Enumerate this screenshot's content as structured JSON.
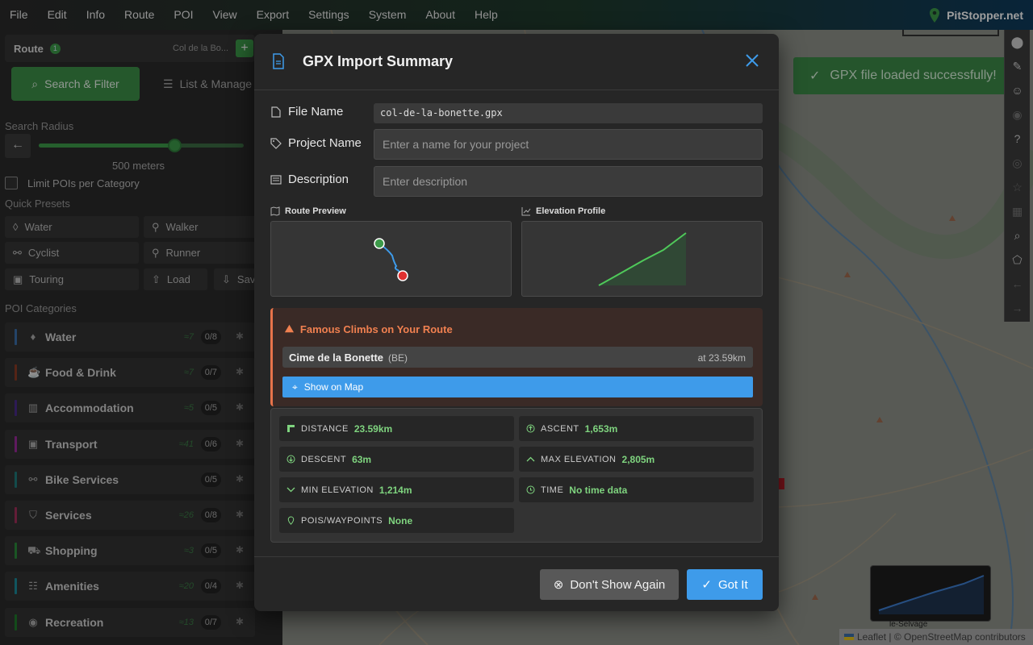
{
  "menu": [
    "File",
    "Edit",
    "Info",
    "Route",
    "POI",
    "View",
    "Export",
    "Settings",
    "System",
    "About",
    "Help"
  ],
  "brand": "PitStopper.net",
  "sidebar": {
    "route_label": "Route",
    "route_count": "1",
    "route_name": "Col de la Bo...",
    "tab_search": "Search & Filter",
    "tab_list": "List & Manage",
    "search_radius_label": "Search Radius",
    "radius_value": "500 meters",
    "radius_fraction": 0.66,
    "limit_label": "Limit POIs per Category",
    "quick_presets_label": "Quick Presets",
    "presets": [
      "Water",
      "Walker",
      "Cyclist",
      "Runner",
      "Touring",
      "Load",
      "Sav"
    ],
    "poi_categories_label": "POI Categories",
    "categories": [
      {
        "name": "Water",
        "count": "≈7",
        "ratio": "0/8",
        "color": "#3a6ea8"
      },
      {
        "name": "Food & Drink",
        "count": "≈7",
        "ratio": "0/7",
        "color": "#8a3a25"
      },
      {
        "name": "Accommodation",
        "count": "≈5",
        "ratio": "0/5",
        "color": "#4a2a8a"
      },
      {
        "name": "Transport",
        "count": "≈41",
        "ratio": "0/6",
        "color": "#9a2a9a"
      },
      {
        "name": "Bike Services",
        "count": "",
        "ratio": "0/5",
        "color": "#1f7a7a"
      },
      {
        "name": "Services",
        "count": "≈26",
        "ratio": "0/8",
        "color": "#a0305a"
      },
      {
        "name": "Shopping",
        "count": "≈3",
        "ratio": "0/5",
        "color": "#2a8a3a"
      },
      {
        "name": "Amenities",
        "count": "≈20",
        "ratio": "0/4",
        "color": "#1a8a9a"
      },
      {
        "name": "Recreation",
        "count": "≈13",
        "ratio": "0/7",
        "color": "#1f7a2a"
      }
    ]
  },
  "map": {
    "toast": "GPX file loaded successfully!",
    "scale": "3 km",
    "place_label": "le-Selvage",
    "attribution": "Leaflet | © OpenStreetMap contributors"
  },
  "modal": {
    "title": "GPX Import Summary",
    "file_name_label": "File Name",
    "file_name": "col-de-la-bonette.gpx",
    "project_name_label": "Project Name",
    "project_placeholder": "Enter a name for your project",
    "description_label": "Description",
    "description_placeholder": "Enter description",
    "route_preview_label": "Route Preview",
    "elevation_profile_label": "Elevation Profile",
    "climbs_title": "Famous Climbs on Your Route",
    "climb_name": "Cime de la Bonette",
    "climb_country": "(BE)",
    "climb_km": "at 23.59km",
    "show_on_map": "Show on Map",
    "stats": {
      "distance_label": "DISTANCE",
      "distance": "23.59km",
      "ascent_label": "ASCENT",
      "ascent": "1,653m",
      "descent_label": "DESCENT",
      "descent": "63m",
      "max_elev_label": "MAX ELEVATION",
      "max_elev": "2,805m",
      "min_elev_label": "MIN ELEVATION",
      "min_elev": "1,214m",
      "time_label": "TIME",
      "time": "No time data",
      "pois_label": "POIS/WAYPOINTS",
      "pois": "None"
    },
    "dont_show_again": "Don't Show Again",
    "got_it": "Got It"
  },
  "colors": {
    "accent_green": "#3d9a4a",
    "accent_blue": "#3e9bea",
    "climb_orange": "#f08050",
    "stat_value": "#7fd47f"
  }
}
